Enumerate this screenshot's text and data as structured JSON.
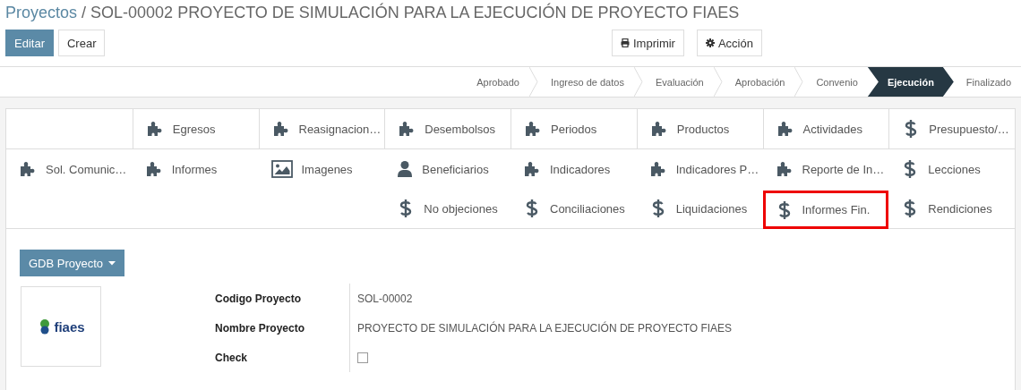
{
  "breadcrumb": {
    "parent": "Proyectos",
    "separator": "/",
    "current": "SOL-00002 PROYECTO DE SIMULACIÓN PARA LA EJECUCIÓN DE PROYECTO FIAES"
  },
  "buttons": [
    {
      "label": "Editar",
      "kind": "primary"
    },
    {
      "label": "Crear",
      "kind": "secondary"
    }
  ],
  "actions": [
    {
      "label": "Imprimir",
      "kind": "print"
    },
    {
      "label": "Acción",
      "kind": "gear"
    }
  ],
  "stages": [
    {
      "label": "Aprobado",
      "selected": false
    },
    {
      "label": "Ingreso de datos",
      "selected": false
    },
    {
      "label": "Evaluación",
      "selected": false
    },
    {
      "label": "Aprobación",
      "selected": false
    },
    {
      "label": "Convenio",
      "selected": false
    },
    {
      "label": "Ejecución",
      "selected": true
    },
    {
      "label": "Finalizado",
      "selected": false
    }
  ],
  "smart_buttons": [
    [
      {
        "label": "Egresos",
        "kind": "puzzle",
        "highlighted": false
      },
      {
        "label": "Reasignacion…",
        "kind": "puzzle",
        "highlighted": false
      },
      {
        "label": "Desembolsos",
        "kind": "puzzle",
        "highlighted": false
      },
      {
        "label": "Periodos",
        "kind": "puzzle",
        "highlighted": false
      },
      {
        "label": "Productos",
        "kind": "puzzle",
        "highlighted": false
      },
      {
        "label": "Actividades",
        "kind": "puzzle",
        "highlighted": false
      },
      {
        "label": "Presupuesto/…",
        "kind": "dollar",
        "highlighted": false
      }
    ],
    [
      {
        "label": "Sol. Comunic…",
        "kind": "puzzle",
        "highlighted": false
      },
      {
        "label": "Informes",
        "kind": "puzzle",
        "highlighted": false
      },
      {
        "label": "Imagenes",
        "kind": "image",
        "highlighted": false
      },
      {
        "label": "Beneficiarios",
        "kind": "user",
        "highlighted": false
      },
      {
        "label": "Indicadores",
        "kind": "puzzle",
        "highlighted": false
      },
      {
        "label": "Indicadores P…",
        "kind": "puzzle",
        "highlighted": false
      },
      {
        "label": "Reporte de In…",
        "kind": "puzzle",
        "highlighted": false
      },
      {
        "label": "Lecciones",
        "kind": "dollar",
        "highlighted": false
      }
    ],
    [
      {
        "label": "No objeciones",
        "kind": "dollar",
        "highlighted": false
      },
      {
        "label": "Conciliaciones",
        "kind": "dollar",
        "highlighted": false
      },
      {
        "label": "Liquidaciones",
        "kind": "dollar",
        "highlighted": false
      },
      {
        "label": "Informes Fin.",
        "kind": "dollar",
        "highlighted": true
      },
      {
        "label": "Rendiciones",
        "kind": "dollar",
        "highlighted": false
      }
    ]
  ],
  "dropdown": {
    "label": "GDB Proyecto"
  },
  "logo": {
    "text": "fiaes"
  },
  "fields": [
    {
      "label": "Codigo Proyecto",
      "kind": "text",
      "value": "SOL-00002"
    },
    {
      "label": "Nombre Proyecto",
      "kind": "text",
      "value": "PROYECTO DE SIMULACIÓN PARA LA EJECUCIÓN DE PROYECTO FIAES"
    },
    {
      "label": "Check",
      "kind": "checkbox",
      "checked": false
    }
  ]
}
